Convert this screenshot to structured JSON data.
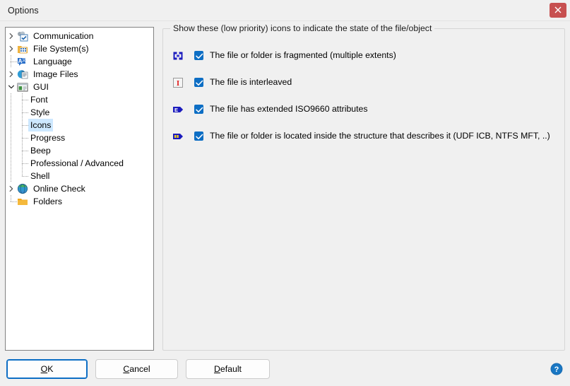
{
  "window": {
    "title": "Options",
    "close_label": "Close",
    "close_icon": "close-icon"
  },
  "tree": {
    "items": [
      {
        "label": "Communication",
        "level": 0,
        "expander": "collapsed",
        "icon": "communication-icon",
        "selected": false
      },
      {
        "label": "File System(s)",
        "level": 0,
        "expander": "collapsed",
        "icon": "file-system-icon",
        "selected": false
      },
      {
        "label": "Language",
        "level": 0,
        "expander": "none",
        "icon": "language-icon",
        "selected": false
      },
      {
        "label": "Image Files",
        "level": 0,
        "expander": "collapsed",
        "icon": "image-files-icon",
        "selected": false
      },
      {
        "label": "GUI",
        "level": 0,
        "expander": "expanded",
        "icon": "gui-icon",
        "selected": false
      },
      {
        "label": "Font",
        "level": 1,
        "expander": "none",
        "icon": "none",
        "selected": false
      },
      {
        "label": "Style",
        "level": 1,
        "expander": "none",
        "icon": "none",
        "selected": false
      },
      {
        "label": "Icons",
        "level": 1,
        "expander": "none",
        "icon": "none",
        "selected": true
      },
      {
        "label": "Progress",
        "level": 1,
        "expander": "none",
        "icon": "none",
        "selected": false
      },
      {
        "label": "Beep",
        "level": 1,
        "expander": "none",
        "icon": "none",
        "selected": false
      },
      {
        "label": "Professional / Advanced",
        "level": 1,
        "expander": "none",
        "icon": "none",
        "selected": false
      },
      {
        "label": "Shell",
        "level": 1,
        "expander": "none",
        "icon": "none",
        "selected": false
      },
      {
        "label": "Online Check",
        "level": 0,
        "expander": "collapsed",
        "icon": "online-check-icon",
        "selected": false
      },
      {
        "label": "Folders",
        "level": 0,
        "expander": "none",
        "icon": "folder-icon",
        "selected": false
      }
    ]
  },
  "group": {
    "title": "Show these (low priority) icons to indicate the state of the file/object",
    "options": [
      {
        "label": "The file or folder is fragmented (multiple extents)",
        "checked": true,
        "icon": "fragmented-icon"
      },
      {
        "label": "The file is interleaved",
        "checked": true,
        "icon": "interleaved-icon"
      },
      {
        "label": "The file has extended ISO9660 attributes",
        "checked": true,
        "icon": "extended-attributes-icon"
      },
      {
        "label": "The file or folder is located inside the structure that describes it (UDF ICB, NTFS MFT, ..)",
        "checked": true,
        "icon": "inside-structure-icon"
      }
    ]
  },
  "footer": {
    "ok": {
      "accel": "O",
      "rest": "K"
    },
    "cancel": {
      "accel": "C",
      "rest": "ancel"
    },
    "default": {
      "accel": "D",
      "rest": "efault"
    },
    "help_icon": "help-icon"
  },
  "colors": {
    "accent": "#0d6ec4",
    "selection": "#cde8ff",
    "close_button": "#c75050",
    "window_bg": "#f0f0f0",
    "panel_bg": "#ffffff",
    "border": "#828282"
  }
}
